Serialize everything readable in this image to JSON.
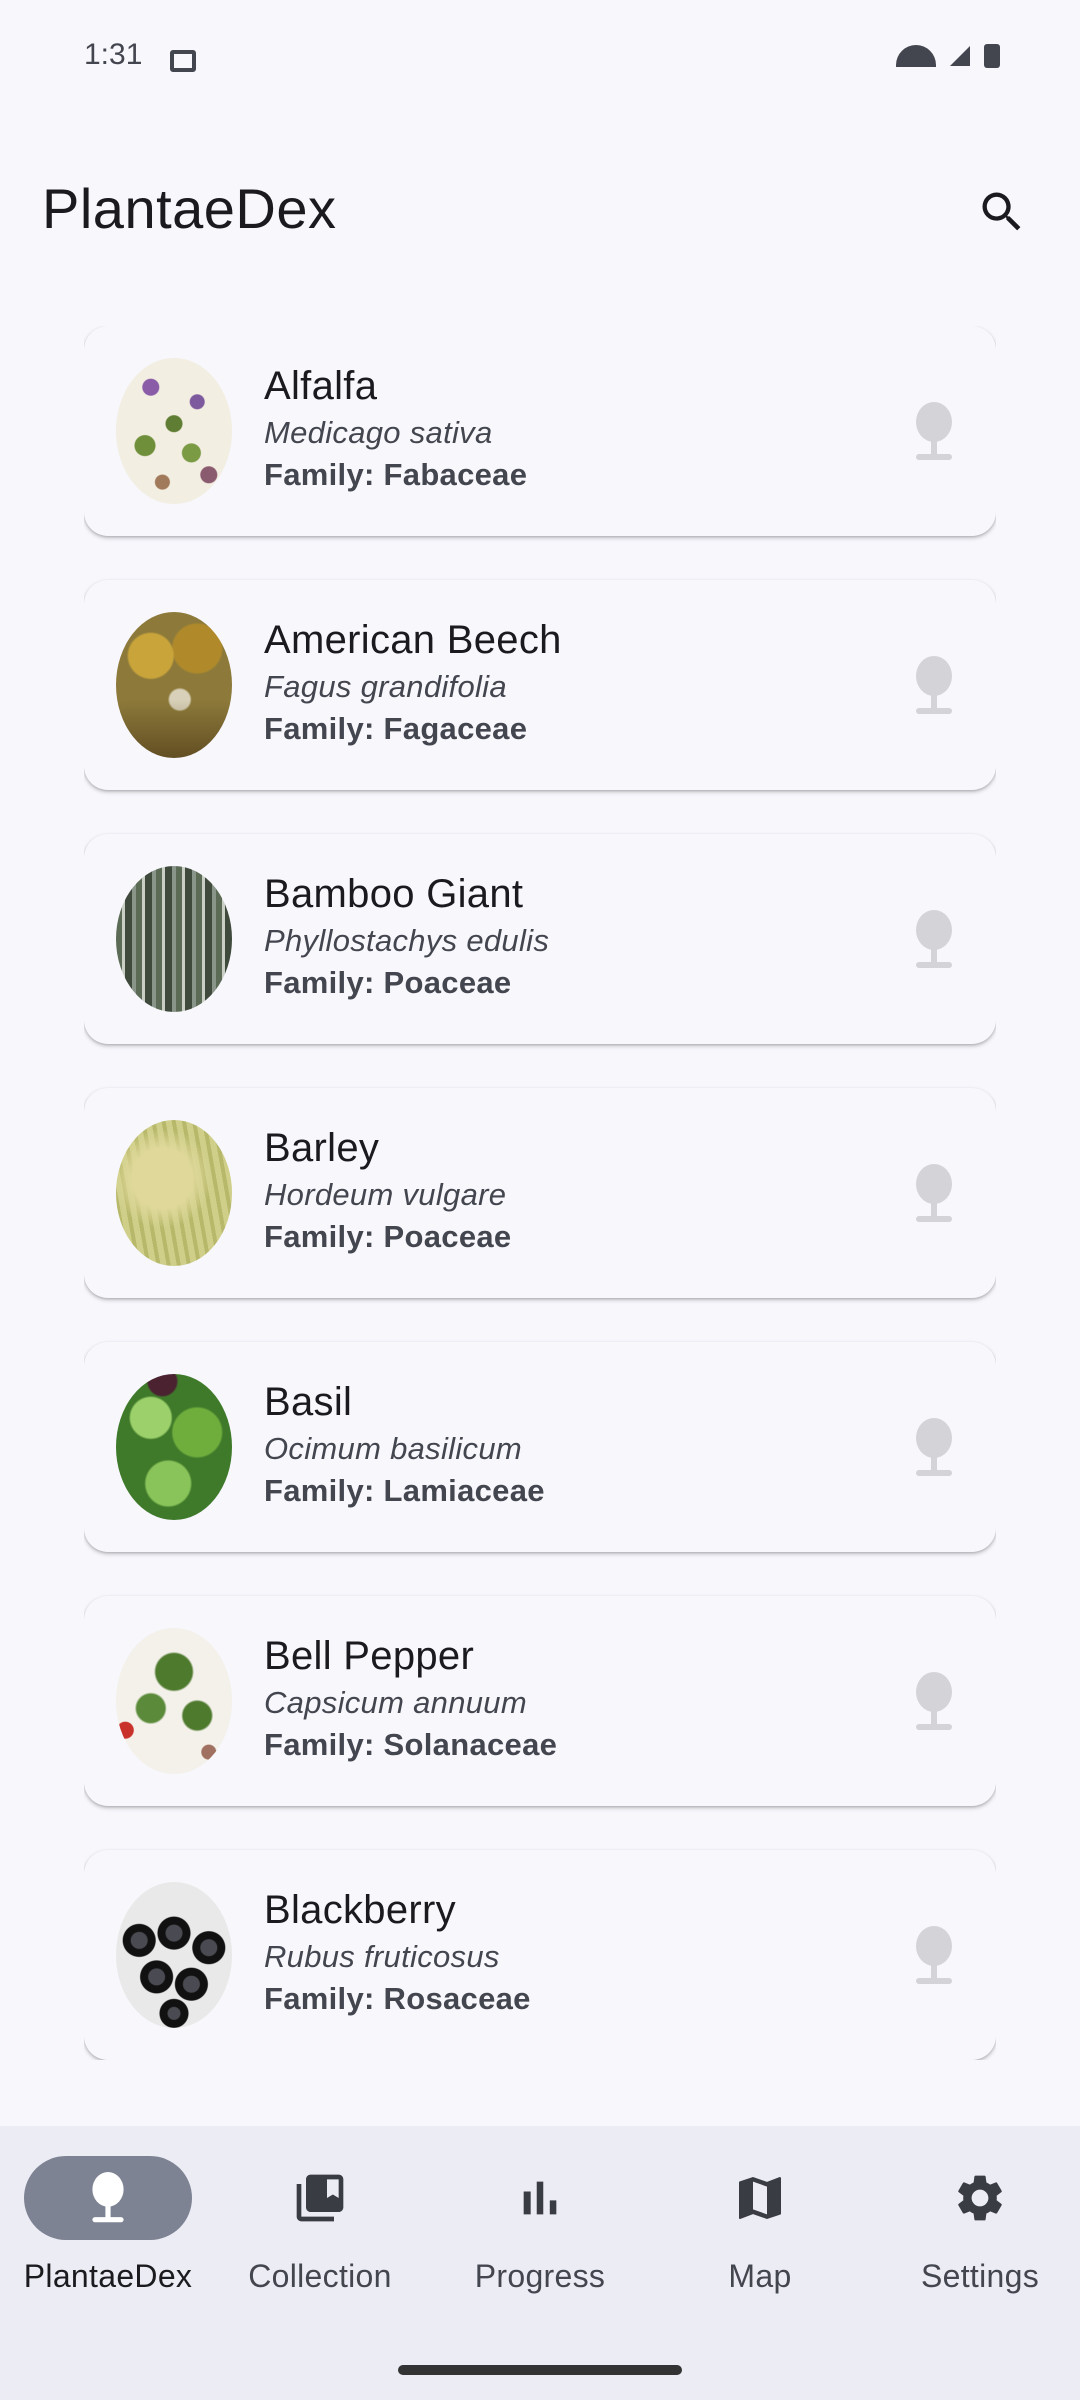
{
  "status_bar": {
    "time": "1:31"
  },
  "app_bar": {
    "title": "PlantaeDex"
  },
  "plants": [
    {
      "name": "Alfalfa",
      "scientific": "Medicago sativa",
      "family": "Family: Fabaceae"
    },
    {
      "name": "American Beech",
      "scientific": "Fagus grandifolia",
      "family": "Family: Fagaceae"
    },
    {
      "name": "Bamboo Giant",
      "scientific": "Phyllostachys edulis",
      "family": "Family: Poaceae"
    },
    {
      "name": "Barley",
      "scientific": "Hordeum vulgare",
      "family": "Family: Poaceae"
    },
    {
      "name": "Basil",
      "scientific": "Ocimum basilicum",
      "family": "Family: Lamiaceae"
    },
    {
      "name": "Bell Pepper",
      "scientific": "Capsicum annuum",
      "family": "Family: Solanaceae"
    },
    {
      "name": "Blackberry",
      "scientific": "Rubus fruticosus",
      "family": "Family: Rosaceae"
    }
  ],
  "bottom_nav": {
    "items": [
      {
        "label": "PlantaeDex",
        "icon": "plant-icon",
        "active": true
      },
      {
        "label": "Collection",
        "icon": "collection-icon",
        "active": false
      },
      {
        "label": "Progress",
        "icon": "bar-chart-icon",
        "active": false
      },
      {
        "label": "Map",
        "icon": "map-icon",
        "active": false
      },
      {
        "label": "Settings",
        "icon": "gear-icon",
        "active": false
      }
    ]
  },
  "colors": {
    "background": "#f7f7fc",
    "nav_background": "#ececf4",
    "active_pill": "#7e8394",
    "discover_icon": "#d3d3d8"
  }
}
